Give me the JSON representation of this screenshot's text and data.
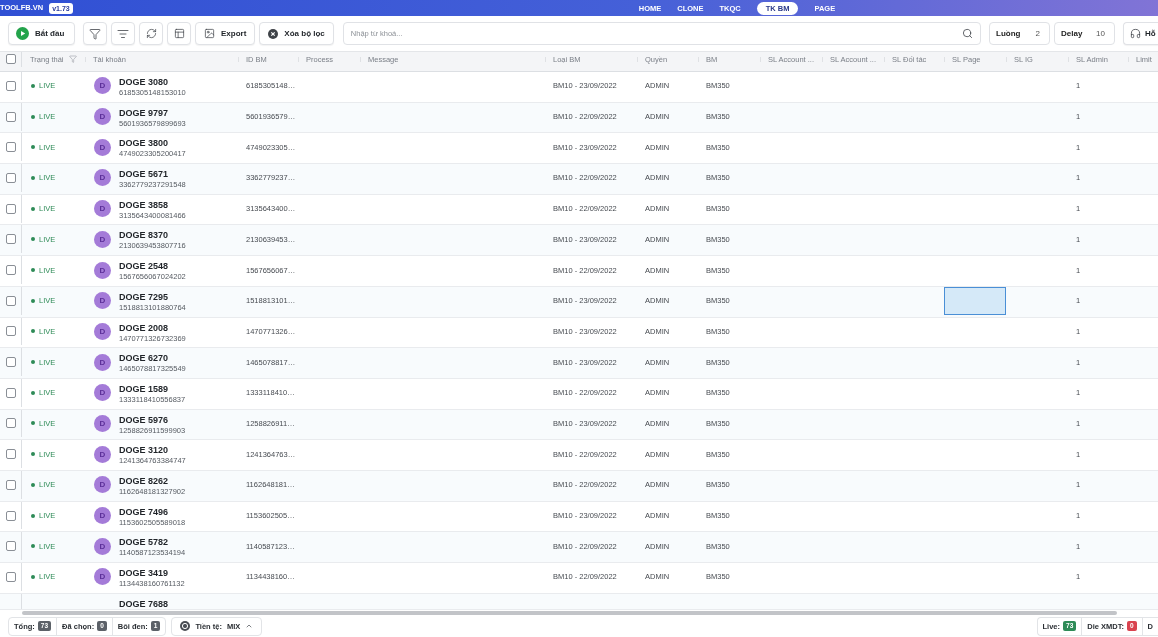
{
  "top_bar": {
    "logo": "TOOLFB.VN",
    "version": "v1.73",
    "nav": [
      {
        "label": "HOME",
        "selected": false
      },
      {
        "label": "CLONE",
        "selected": false
      },
      {
        "label": "TKQC",
        "selected": false
      },
      {
        "label": "TK BM",
        "selected": true
      },
      {
        "label": "PAGE",
        "selected": false
      }
    ]
  },
  "toolbar": {
    "start_button": "Bắt đầu",
    "export_button": "Export",
    "clear_filter_button": "Xóa bộ lọc",
    "search": {
      "placeholder": "Nhập từ khoá..."
    },
    "threads": {
      "label": "Luồng",
      "value": "2"
    },
    "delay": {
      "label": "Delay",
      "value": "10"
    },
    "support_button": "Hỗ"
  },
  "table": {
    "select_all_checked": false,
    "columns": [
      {
        "label": "Trạng thái",
        "filterable": true
      },
      {
        "label": "Tài khoản",
        "filterable": false
      },
      {
        "label": "ID BM",
        "filterable": false
      },
      {
        "label": "Process",
        "filterable": false
      },
      {
        "label": "Message",
        "filterable": false
      },
      {
        "label": "Loại BM",
        "filterable": false
      },
      {
        "label": "Quyền",
        "filterable": false
      },
      {
        "label": "BM",
        "filterable": false
      },
      {
        "label": "SL Account ...",
        "filterable": false
      },
      {
        "label": "SL Account ...",
        "filterable": false
      },
      {
        "label": "SL Đối tác",
        "filterable": false
      },
      {
        "label": "SL Page",
        "filterable": false
      },
      {
        "label": "SL IG",
        "filterable": false
      },
      {
        "label": "SL Admin",
        "filterable": false
      },
      {
        "label": "Limit",
        "filterable": false
      }
    ],
    "rows": [
      {
        "checked": false,
        "status": "LIVE",
        "avatar": "D",
        "name": "DOGE 3080",
        "account_id": "6185305148153010",
        "id_bm": "6185305148…",
        "loai_bm": "BM10 - 23/09/2022",
        "quyen": "ADMIN",
        "bm": "BM350",
        "sl_admin": "1",
        "sl_page_selected": false
      },
      {
        "checked": false,
        "status": "LIVE",
        "avatar": "D",
        "name": "DOGE 9797",
        "account_id": "5601936579899693",
        "id_bm": "5601936579…",
        "loai_bm": "BM10 - 22/09/2022",
        "quyen": "ADMIN",
        "bm": "BM350",
        "sl_admin": "1",
        "sl_page_selected": false
      },
      {
        "checked": false,
        "status": "LIVE",
        "avatar": "D",
        "name": "DOGE 3800",
        "account_id": "4749023305200417",
        "id_bm": "4749023305…",
        "loai_bm": "BM10 - 23/09/2022",
        "quyen": "ADMIN",
        "bm": "BM350",
        "sl_admin": "1",
        "sl_page_selected": false
      },
      {
        "checked": false,
        "status": "LIVE",
        "avatar": "D",
        "name": "DOGE 5671",
        "account_id": "3362779237291548",
        "id_bm": "3362779237…",
        "loai_bm": "BM10 - 22/09/2022",
        "quyen": "ADMIN",
        "bm": "BM350",
        "sl_admin": "1",
        "sl_page_selected": false
      },
      {
        "checked": false,
        "status": "LIVE",
        "avatar": "D",
        "name": "DOGE 3858",
        "account_id": "3135643400081466",
        "id_bm": "3135643400…",
        "loai_bm": "BM10 - 22/09/2022",
        "quyen": "ADMIN",
        "bm": "BM350",
        "sl_admin": "1",
        "sl_page_selected": false
      },
      {
        "checked": false,
        "status": "LIVE",
        "avatar": "D",
        "name": "DOGE 8370",
        "account_id": "2130639453807716",
        "id_bm": "2130639453…",
        "loai_bm": "BM10 - 23/09/2022",
        "quyen": "ADMIN",
        "bm": "BM350",
        "sl_admin": "1",
        "sl_page_selected": false
      },
      {
        "checked": false,
        "status": "LIVE",
        "avatar": "D",
        "name": "DOGE 2548",
        "account_id": "1567656067024202",
        "id_bm": "1567656067…",
        "loai_bm": "BM10 - 22/09/2022",
        "quyen": "ADMIN",
        "bm": "BM350",
        "sl_admin": "1",
        "sl_page_selected": false
      },
      {
        "checked": false,
        "status": "LIVE",
        "avatar": "D",
        "name": "DOGE 7295",
        "account_id": "1518813101880764",
        "id_bm": "1518813101…",
        "loai_bm": "BM10 - 23/09/2022",
        "quyen": "ADMIN",
        "bm": "BM350",
        "sl_admin": "1",
        "sl_page_selected": true
      },
      {
        "checked": false,
        "status": "LIVE",
        "avatar": "D",
        "name": "DOGE 2008",
        "account_id": "1470771326732369",
        "id_bm": "1470771326…",
        "loai_bm": "BM10 - 23/09/2022",
        "quyen": "ADMIN",
        "bm": "BM350",
        "sl_admin": "1",
        "sl_page_selected": false
      },
      {
        "checked": false,
        "status": "LIVE",
        "avatar": "D",
        "name": "DOGE 6270",
        "account_id": "1465078817325549",
        "id_bm": "1465078817…",
        "loai_bm": "BM10 - 23/09/2022",
        "quyen": "ADMIN",
        "bm": "BM350",
        "sl_admin": "1",
        "sl_page_selected": false
      },
      {
        "checked": false,
        "status": "LIVE",
        "avatar": "D",
        "name": "DOGE 1589",
        "account_id": "1333118410556837",
        "id_bm": "1333118410…",
        "loai_bm": "BM10 - 22/09/2022",
        "quyen": "ADMIN",
        "bm": "BM350",
        "sl_admin": "1",
        "sl_page_selected": false
      },
      {
        "checked": false,
        "status": "LIVE",
        "avatar": "D",
        "name": "DOGE 5976",
        "account_id": "1258826911599903",
        "id_bm": "1258826911…",
        "loai_bm": "BM10 - 23/09/2022",
        "quyen": "ADMIN",
        "bm": "BM350",
        "sl_admin": "1",
        "sl_page_selected": false
      },
      {
        "checked": false,
        "status": "LIVE",
        "avatar": "D",
        "name": "DOGE 3120",
        "account_id": "1241364763384747",
        "id_bm": "1241364763…",
        "loai_bm": "BM10 - 22/09/2022",
        "quyen": "ADMIN",
        "bm": "BM350",
        "sl_admin": "1",
        "sl_page_selected": false
      },
      {
        "checked": false,
        "status": "LIVE",
        "avatar": "D",
        "name": "DOGE 8262",
        "account_id": "1162648181327902",
        "id_bm": "1162648181…",
        "loai_bm": "BM10 - 22/09/2022",
        "quyen": "ADMIN",
        "bm": "BM350",
        "sl_admin": "1",
        "sl_page_selected": false
      },
      {
        "checked": false,
        "status": "LIVE",
        "avatar": "D",
        "name": "DOGE 7496",
        "account_id": "1153602505589018",
        "id_bm": "1153602505…",
        "loai_bm": "BM10 - 23/09/2022",
        "quyen": "ADMIN",
        "bm": "BM350",
        "sl_admin": "1",
        "sl_page_selected": false
      },
      {
        "checked": false,
        "status": "LIVE",
        "avatar": "D",
        "name": "DOGE 5782",
        "account_id": "1140587123534194",
        "id_bm": "1140587123…",
        "loai_bm": "BM10 - 22/09/2022",
        "quyen": "ADMIN",
        "bm": "BM350",
        "sl_admin": "1",
        "sl_page_selected": false
      },
      {
        "checked": false,
        "status": "LIVE",
        "avatar": "D",
        "name": "DOGE 3419",
        "account_id": "1134438160761132",
        "id_bm": "1134438160…",
        "loai_bm": "BM10 - 22/09/2022",
        "quyen": "ADMIN",
        "bm": "BM350",
        "sl_admin": "1",
        "sl_page_selected": false
      },
      {
        "name": "DOGE 7688"
      }
    ]
  },
  "footer": {
    "stats": [
      {
        "label": "Tổng:",
        "count": "73"
      },
      {
        "label": "Đã chọn:",
        "count": "0"
      },
      {
        "label": "Bôi đen:",
        "count": "1"
      }
    ],
    "currency": {
      "label": "Tiền tệ:",
      "value": "MIX"
    },
    "status_counts": [
      {
        "label": "Live:",
        "count": "73",
        "color": "#2e8b57"
      },
      {
        "label": "Die XMDT:",
        "count": "0",
        "color": "#d9434f"
      },
      {
        "label": "D"
      }
    ]
  }
}
